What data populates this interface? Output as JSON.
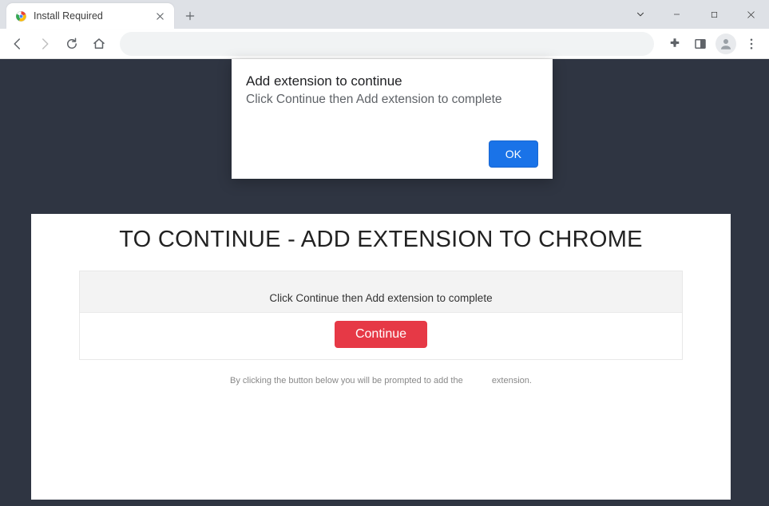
{
  "tab": {
    "title": "Install Required"
  },
  "popup": {
    "heading": "Add extension to continue",
    "subtext": "Click Continue then Add extension to complete",
    "ok_label": "OK"
  },
  "page": {
    "heading": "TO CONTINUE - ADD EXTENSION TO CHROME",
    "instruction": "Click Continue then Add extension to complete",
    "continue_label": "Continue",
    "fineprint_left": "By clicking the button below you will be prompted to add the",
    "fineprint_right": "extension."
  }
}
